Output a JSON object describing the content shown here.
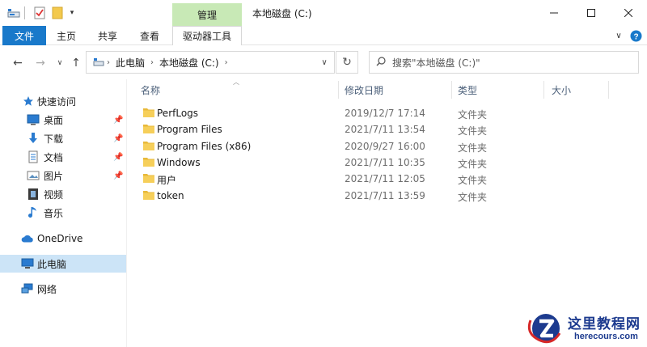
{
  "titlebar": {
    "context_tab": "管理",
    "window_title": "本地磁盘 (C:)"
  },
  "ribbon": {
    "tabs": [
      "文件",
      "主页",
      "共享",
      "查看",
      "驱动器工具"
    ]
  },
  "address": {
    "crumbs": [
      "此电脑",
      "本地磁盘 (C:)"
    ],
    "search_placeholder": "搜索\"本地磁盘 (C:)\""
  },
  "nav": {
    "quick_access": "快速访问",
    "items": [
      {
        "label": "桌面",
        "icon": "desktop-icon",
        "pinned": true
      },
      {
        "label": "下载",
        "icon": "download-icon",
        "pinned": true
      },
      {
        "label": "文档",
        "icon": "document-icon",
        "pinned": true
      },
      {
        "label": "图片",
        "icon": "picture-icon",
        "pinned": true
      },
      {
        "label": "视频",
        "icon": "video-icon",
        "pinned": false
      },
      {
        "label": "音乐",
        "icon": "music-icon",
        "pinned": false
      }
    ],
    "onedrive": "OneDrive",
    "this_pc": "此电脑",
    "network": "网络"
  },
  "columns": {
    "name": "名称",
    "date": "修改日期",
    "type": "类型",
    "size": "大小"
  },
  "files": [
    {
      "name": "PerfLogs",
      "date": "2019/12/7 17:14",
      "type": "文件夹"
    },
    {
      "name": "Program Files",
      "date": "2021/7/11 13:54",
      "type": "文件夹"
    },
    {
      "name": "Program Files (x86)",
      "date": "2020/9/27 16:00",
      "type": "文件夹"
    },
    {
      "name": "Windows",
      "date": "2021/7/11 10:35",
      "type": "文件夹"
    },
    {
      "name": "用户",
      "date": "2021/7/11 12:05",
      "type": "文件夹"
    },
    {
      "name": "token",
      "date": "2021/7/11 13:59",
      "type": "文件夹"
    }
  ],
  "watermark": {
    "title": "这里教程网",
    "url": "herecours.com"
  },
  "colors": {
    "file_tab": "#1979ca",
    "context_tab": "#c8e9b6",
    "selected_nav": "#cce4f7",
    "folder": "#f3c94d",
    "watermark": "#1d3b8f"
  }
}
